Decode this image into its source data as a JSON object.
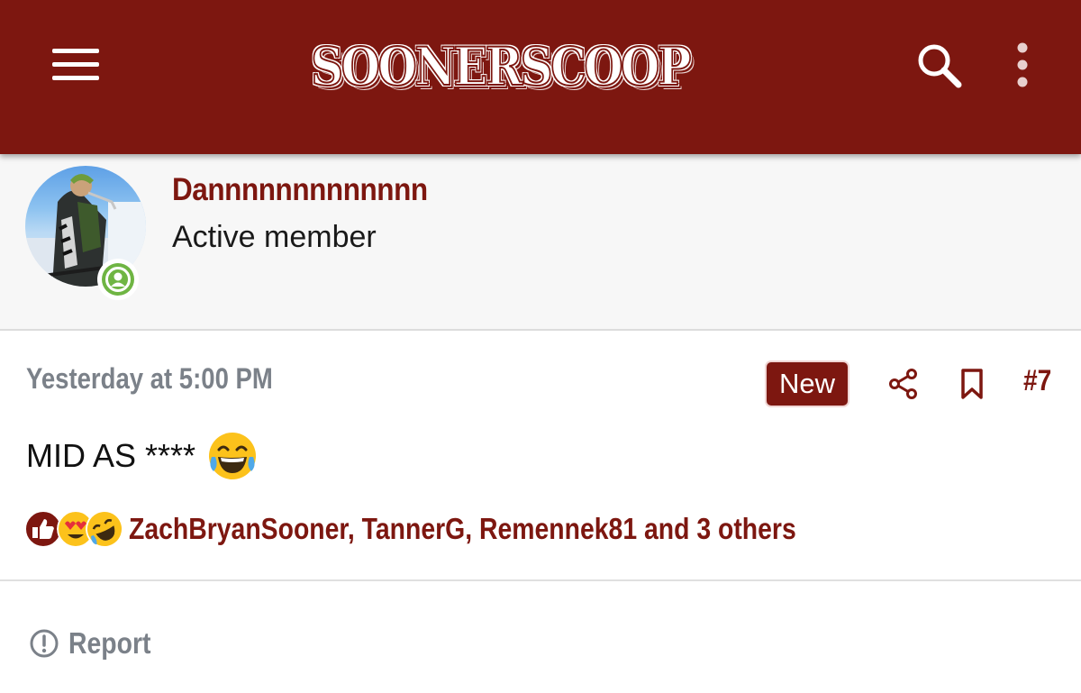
{
  "header": {
    "logo_text": "SOONERSCOOP",
    "brand_color": "#7d1710",
    "icons": [
      "menu-icon",
      "search-icon",
      "more-vertical-icon"
    ]
  },
  "member": {
    "username": "Dannnnnnnnnnnnn",
    "title": "Active member",
    "status_icon": "online-user-icon"
  },
  "post": {
    "date": "Yesterday at 5:00 PM",
    "new_badge": "New",
    "number": "#7",
    "text": "MID AS ****",
    "emoji": "laughing-tears-emoji",
    "icons": [
      "share-icon",
      "bookmark-icon"
    ]
  },
  "reactions": {
    "icons": [
      "like-icon",
      "love-icon",
      "rofl-icon"
    ],
    "summary": "ZachBryanSooner, TannerG, Remennek81 and 3 others"
  },
  "footer": {
    "report_label": "Report",
    "report_icon": "alert-circle-icon"
  }
}
